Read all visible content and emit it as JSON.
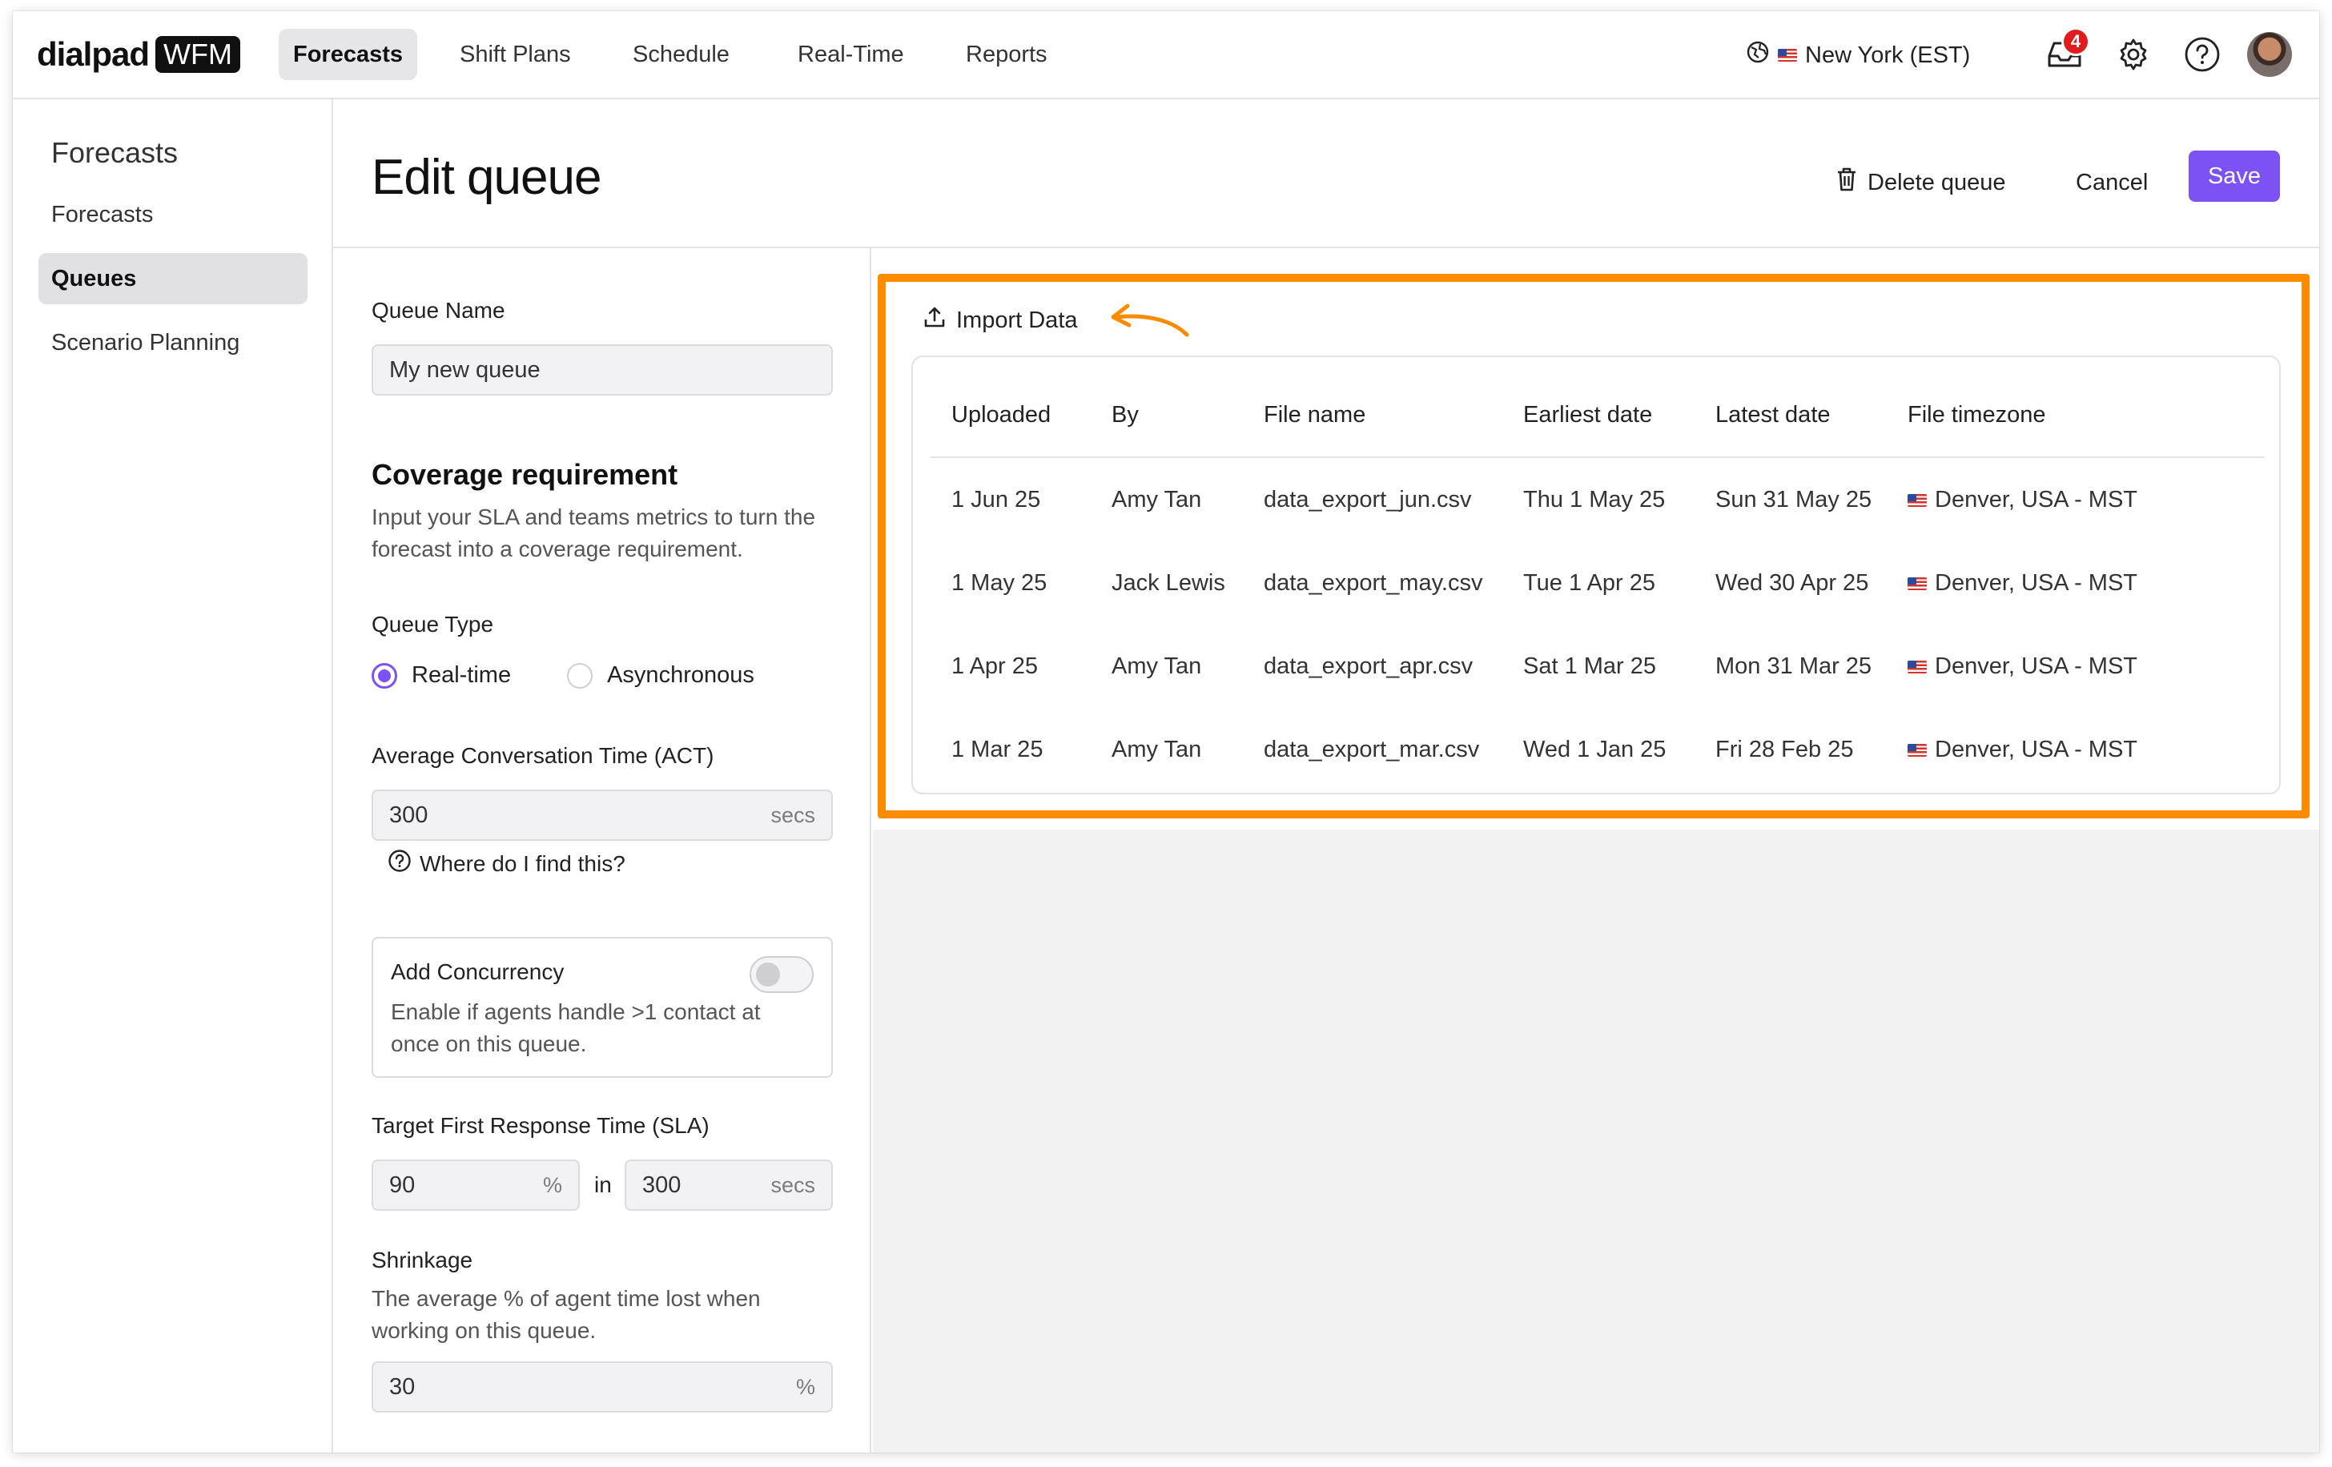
{
  "brand": {
    "name": "dialpad",
    "product": "WFM"
  },
  "nav": {
    "tabs": [
      {
        "label": "Forecasts",
        "active": true
      },
      {
        "label": "Shift Plans",
        "active": false
      },
      {
        "label": "Schedule",
        "active": false
      },
      {
        "label": "Real-Time",
        "active": false
      },
      {
        "label": "Reports",
        "active": false
      }
    ],
    "timezone": "New York (EST)",
    "notifications_count": "4",
    "icons": [
      "globe-icon",
      "flag-us-icon",
      "inbox-icon",
      "gear-icon",
      "help-icon",
      "avatar"
    ]
  },
  "sidebar": {
    "title": "Forecasts",
    "items": [
      {
        "label": "Forecasts",
        "active": false
      },
      {
        "label": "Queues",
        "active": true
      },
      {
        "label": "Scenario Planning",
        "active": false
      }
    ]
  },
  "header": {
    "title": "Edit queue",
    "delete_label": "Delete queue",
    "cancel_label": "Cancel",
    "save_label": "Save"
  },
  "form": {
    "queue_name_label": "Queue Name",
    "queue_name_value": "My new queue",
    "coverage_title": "Coverage requirement",
    "coverage_desc": "Input your SLA and teams metrics to turn the forecast into a coverage requirement.",
    "queue_type_label": "Queue Type",
    "queue_type_options": [
      {
        "label": "Real-time",
        "selected": true
      },
      {
        "label": "Asynchronous",
        "selected": false
      }
    ],
    "act_label": "Average Conversation Time (ACT)",
    "act_value": "300",
    "act_unit": "secs",
    "help_link": "Where do I find this?",
    "concurrency_title": "Add Concurrency",
    "concurrency_desc": "Enable if agents handle >1 contact at once on this queue.",
    "concurrency_enabled": false,
    "sla_label": "Target First Response Time (SLA)",
    "sla_percent_value": "90",
    "sla_percent_unit": "%",
    "sla_in": "in",
    "sla_secs_value": "300",
    "sla_secs_unit": "secs",
    "shrinkage_label": "Shrinkage",
    "shrinkage_desc": "The average % of agent time lost when working on this queue.",
    "shrinkage_value": "30",
    "shrinkage_unit": "%"
  },
  "import": {
    "label": "Import Data",
    "highlight_color": "#fb8c00"
  },
  "table": {
    "columns": [
      "Uploaded",
      "By",
      "File name",
      "Earliest date",
      "Latest date",
      "File timezone"
    ],
    "rows": [
      [
        "1 Jun 25",
        "Amy Tan",
        "data_export_jun.csv",
        "Thu 1 May 25",
        "Sun 31 May 25",
        "Denver, USA - MST"
      ],
      [
        "1 May 25",
        "Jack Lewis",
        "data_export_may.csv",
        "Tue 1 Apr 25",
        "Wed 30 Apr 25",
        "Denver, USA - MST"
      ],
      [
        "1 Apr 25",
        "Amy Tan",
        "data_export_apr.csv",
        "Sat 1 Mar 25",
        "Mon 31 Mar 25",
        "Denver, USA - MST"
      ],
      [
        "1 Mar 25",
        "Amy Tan",
        "data_export_mar.csv",
        "Wed 1 Jan 25",
        "Fri 28 Feb 25",
        "Denver, USA - MST"
      ]
    ]
  },
  "colors": {
    "accent": "#7c52f4",
    "highlight": "#fb8c00",
    "badge": "#e01d1d"
  }
}
